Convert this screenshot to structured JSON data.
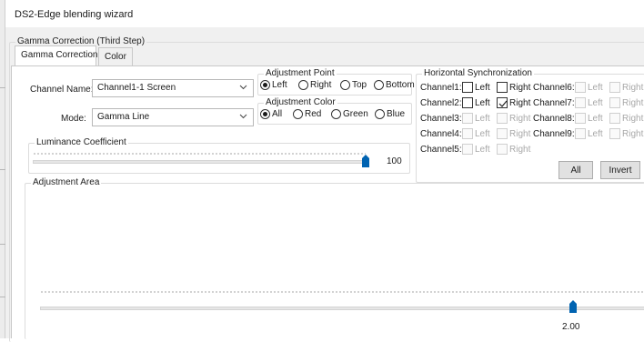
{
  "window": {
    "title": "DS2-Edge blending wizard"
  },
  "step_group": {
    "label": "Gamma Correction (Third Step)"
  },
  "tabs": [
    {
      "label": "Gamma Correction",
      "active": true
    },
    {
      "label": "Color",
      "active": false
    }
  ],
  "channel_name": {
    "label": "Channel Name:",
    "value": "Channel1-1 Screen",
    "icon": "chevron-down-icon"
  },
  "mode": {
    "label": "Mode:",
    "value": "Gamma Line",
    "icon": "chevron-down-icon"
  },
  "adjustment_point": {
    "label": "Adjustment Point",
    "options": [
      "Left",
      "Right",
      "Top",
      "Bottom"
    ],
    "selected": "Left"
  },
  "adjustment_color": {
    "label": "Adjustment Color",
    "options": [
      "All",
      "Red",
      "Green",
      "Blue"
    ],
    "selected": "All"
  },
  "luminance": {
    "label": "Luminance Coefficient",
    "value": "100",
    "level": 1.0
  },
  "horizontal_sync": {
    "label": "Horizontal Synchronization",
    "left_label": "Left",
    "right_label": "Right",
    "channels": [
      {
        "label": "Channel1:",
        "left_enabled": true,
        "left_checked": false,
        "right_enabled": true,
        "right_checked": false
      },
      {
        "label": "Channel2:",
        "left_enabled": true,
        "left_checked": false,
        "right_enabled": true,
        "right_checked": true
      },
      {
        "label": "Channel3:",
        "left_enabled": false,
        "left_checked": false,
        "right_enabled": false,
        "right_checked": false
      },
      {
        "label": "Channel4:",
        "left_enabled": false,
        "left_checked": false,
        "right_enabled": false,
        "right_checked": false
      },
      {
        "label": "Channel5:",
        "left_enabled": false,
        "left_checked": false,
        "right_enabled": false,
        "right_checked": false
      },
      {
        "label": "Channel6:",
        "left_enabled": false,
        "left_checked": false,
        "right_enabled": false,
        "right_checked": false
      },
      {
        "label": "Channel7:",
        "left_enabled": false,
        "left_checked": false,
        "right_enabled": false,
        "right_checked": false
      },
      {
        "label": "Channel8:",
        "left_enabled": false,
        "left_checked": false,
        "right_enabled": false,
        "right_checked": false
      },
      {
        "label": "Channel9:",
        "left_enabled": false,
        "left_checked": false,
        "right_enabled": false,
        "right_checked": false
      }
    ],
    "all_button": "All",
    "invert_button": "Invert"
  },
  "adjustment_area": {
    "label": "Adjustment Area",
    "value": "2.00"
  },
  "colors": {
    "thumb": "#0063b1",
    "panel": "#f0f0f0",
    "border": "#dcdcdc"
  }
}
